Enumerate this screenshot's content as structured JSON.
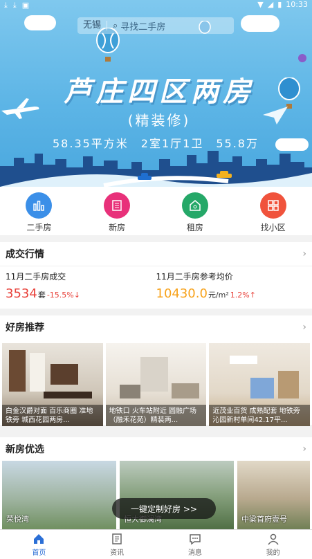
{
  "status_bar": {
    "time": "10:33"
  },
  "search": {
    "city": "无锡",
    "placeholder": "寻找二手房"
  },
  "banner": {
    "title": "芦庄四区两房",
    "subtitle": "(精装修)",
    "specs": "58.35平方米　2室1厅1卫　55.8万"
  },
  "nav": [
    {
      "label": "二手房",
      "icon": "building-chart-icon",
      "color": "#3b8fe8"
    },
    {
      "label": "新房",
      "icon": "new-building-icon",
      "color": "#e8317a"
    },
    {
      "label": "租房",
      "icon": "rent-house-icon",
      "color": "#25a868"
    },
    {
      "label": "找小区",
      "icon": "grid-community-icon",
      "color": "#f0533c"
    }
  ],
  "deals": {
    "title": "成交行情",
    "left": {
      "label": "11月二手房成交",
      "value": "3534",
      "unit": "套",
      "change": "-15.5%↓"
    },
    "right": {
      "label": "11月二手房参考均价",
      "value": "10430.0",
      "unit": "元/m²",
      "change": "1.2%↑"
    }
  },
  "recommend": {
    "title": "好房推荐",
    "items": [
      {
        "caption": "白金汉爵对面 百乐商圈 准地铁旁 城西花园两房..."
      },
      {
        "caption": "地铁口 火车站附近 圆融广场（融禾花苑）精装两..."
      },
      {
        "caption": "近茂业百货 成熟配套 地铁旁 沁园新村单间42.17平..."
      }
    ]
  },
  "newhomes": {
    "title": "新房优选",
    "items": [
      {
        "caption": "荣悦湾"
      },
      {
        "caption": "恒大御澜湾"
      },
      {
        "caption": "中粱首府壹号"
      }
    ]
  },
  "float_button": "一键定制好房 >>",
  "tabs": [
    {
      "label": "首页",
      "active": true
    },
    {
      "label": "资讯",
      "active": false
    },
    {
      "label": "消息",
      "active": false
    },
    {
      "label": "我的",
      "active": false
    }
  ]
}
